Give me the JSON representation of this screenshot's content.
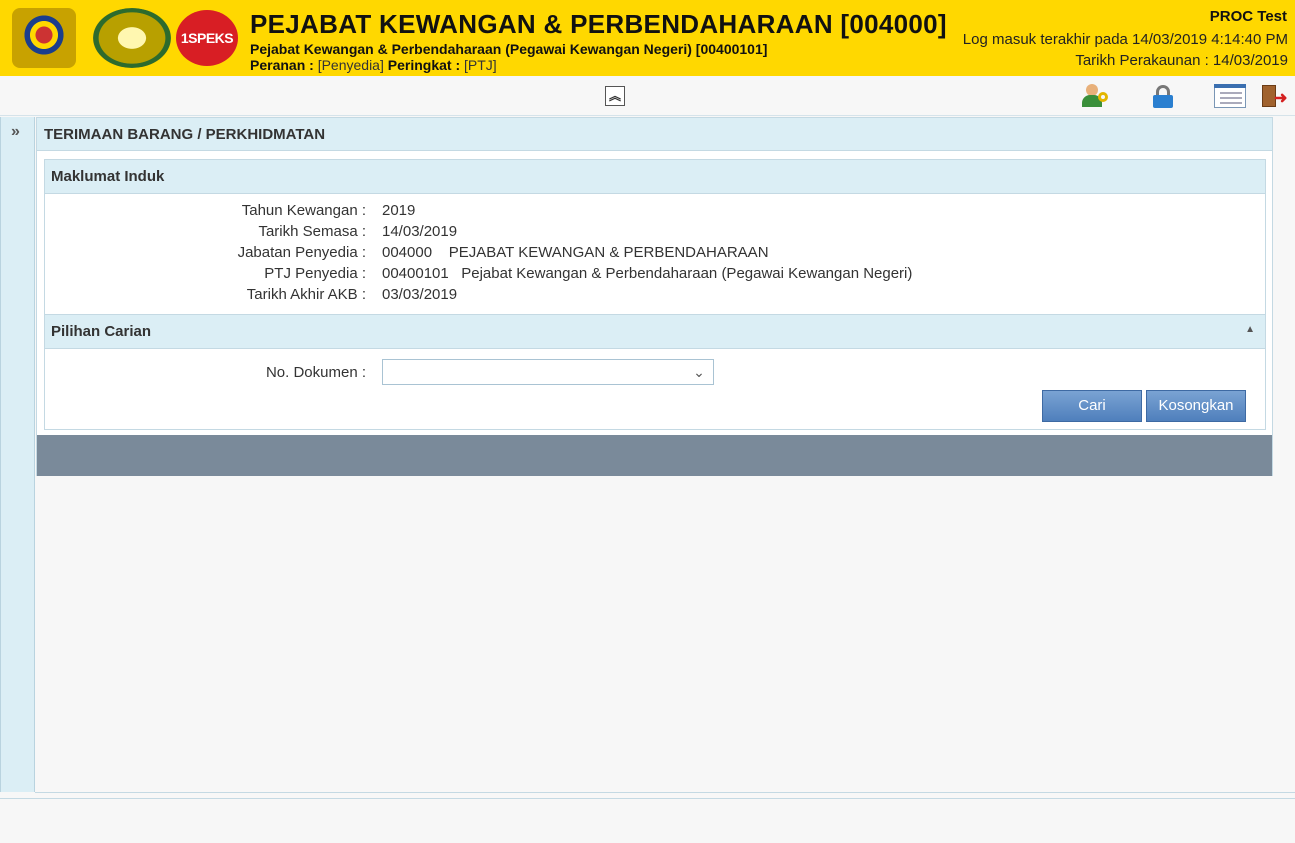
{
  "header": {
    "title": "PEJABAT KEWANGAN & PERBENDAHARAAN [004000]",
    "subtitle": "Pejabat Kewangan & Perbendaharaan (Pegawai Kewangan Negeri) [00400101]",
    "role_label": "Peranan :",
    "role_value": "[Penyedia]",
    "level_label": "Peringkat :",
    "level_value": "[PTJ]",
    "user": "PROC Test",
    "last_login": "Log masuk terakhir pada 14/03/2019 4:14:40 PM",
    "account_date": "Tarikh Perakaunan : 14/03/2019",
    "logo3_text": "1SPEKS"
  },
  "page": {
    "title": "TERIMAAN BARANG / PERKHIDMATAN"
  },
  "maklumat": {
    "heading": "Maklumat Induk",
    "rows": [
      {
        "label": "Tahun Kewangan :",
        "value": "2019"
      },
      {
        "label": "Tarikh Semasa :",
        "value": "14/03/2019"
      },
      {
        "label": "Jabatan Penyedia :",
        "value": "004000    PEJABAT KEWANGAN & PERBENDAHARAAN"
      },
      {
        "label": "PTJ Penyedia :",
        "value": "00400101   Pejabat Kewangan & Perbendaharaan (Pegawai Kewangan Negeri)"
      },
      {
        "label": "Tarikh Akhir AKB :",
        "value": "03/03/2019"
      }
    ]
  },
  "carian": {
    "heading": "Pilihan Carian",
    "doc_label": "No. Dokumen :",
    "doc_value": "",
    "search_button": "Cari",
    "clear_button": "Kosongkan"
  }
}
